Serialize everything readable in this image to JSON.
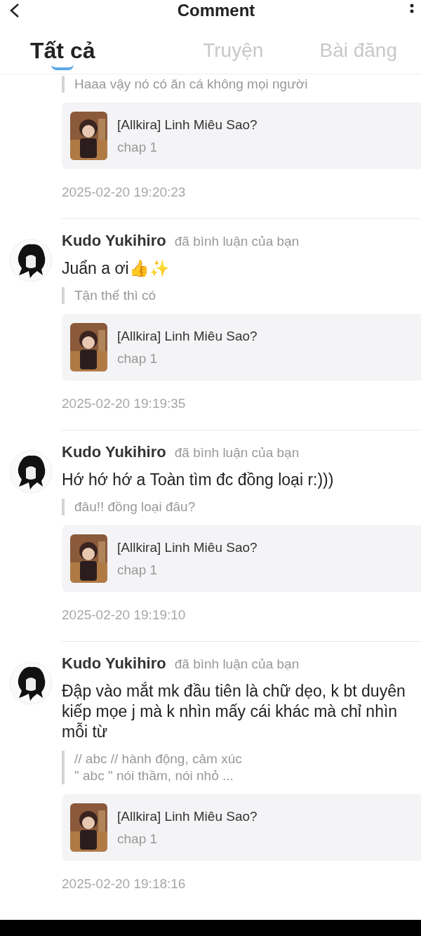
{
  "header": {
    "title": "Comment"
  },
  "tabs": [
    {
      "label": "Tất cả",
      "selected": true
    },
    {
      "label": "Truyện",
      "selected": false
    },
    {
      "label": "Bài đăng",
      "selected": false
    }
  ],
  "comments": [
    {
      "quote": [
        "Haaa vậy nó có ăn cá không mọi người"
      ],
      "story": {
        "title": "[Allkira] Linh Miêu Sao?",
        "chapter": "chap 1"
      },
      "time": "2025-02-20 19:20:23"
    },
    {
      "user": "Kudo Yukihiro",
      "action": "đã bình luận của bạn",
      "text": "Juẩn a ơi👍✨",
      "quote": [
        "Tận thế thì có"
      ],
      "story": {
        "title": "[Allkira] Linh Miêu Sao?",
        "chapter": "chap 1"
      },
      "time": "2025-02-20 19:19:35"
    },
    {
      "user": "Kudo Yukihiro",
      "action": "đã bình luận của bạn",
      "text": "Hớ hớ hớ a Toàn tìm đc đồng loại r:)))",
      "quote": [
        "đâu!! đồng loại đâu?"
      ],
      "story": {
        "title": "[Allkira] Linh Miêu Sao?",
        "chapter": "chap 1"
      },
      "time": "2025-02-20 19:19:10"
    },
    {
      "user": "Kudo Yukihiro",
      "action": "đã bình luận của bạn",
      "text": "Đập vào mắt mk đầu tiên là chữ dẹo, k bt duyên kiếp mọe j mà k nhìn mấy cái khác mà chỉ nhìn mỗi từ",
      "quote": [
        "// abc // hành động, cảm xúc",
        "\" abc \" nói thầm, nói nhỏ ..."
      ],
      "story": {
        "title": "[Allkira] Linh Miêu Sao?",
        "chapter": "chap 1"
      },
      "time": "2025-02-20 19:18:16"
    }
  ]
}
